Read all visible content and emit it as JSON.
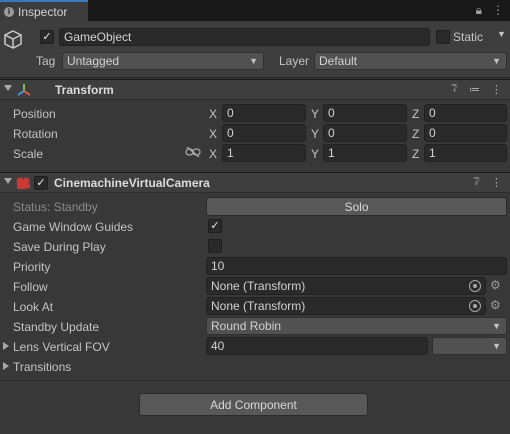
{
  "tab": {
    "title": "Inspector",
    "icon": "info-icon"
  },
  "tab_actions": {
    "lock": "lock-icon",
    "menu": "menu-icon"
  },
  "header": {
    "name": "GameObject",
    "active": true,
    "static_label": "Static",
    "tag_label": "Tag",
    "tag_value": "Untagged",
    "layer_label": "Layer",
    "layer_value": "Default"
  },
  "transform": {
    "title": "Transform",
    "rows": [
      {
        "label": "Position",
        "x": "0",
        "y": "0",
        "z": "0"
      },
      {
        "label": "Rotation",
        "x": "0",
        "y": "0",
        "z": "0"
      },
      {
        "label": "Scale",
        "x": "1",
        "y": "1",
        "z": "1"
      }
    ],
    "axis_x": "X",
    "axis_y": "Y",
    "axis_z": "Z"
  },
  "vcam": {
    "title": "CinemachineVirtualCamera",
    "enabled": true,
    "status": "Status: Standby",
    "solo": "Solo",
    "game_window_guides": "Game Window Guides",
    "game_window_guides_checked": true,
    "save_during_play": "Save During Play",
    "save_during_play_checked": false,
    "priority_label": "Priority",
    "priority_value": "10",
    "follow_label": "Follow",
    "follow_value": "None (Transform)",
    "lookat_label": "Look At",
    "lookat_value": "None (Transform)",
    "standby_label": "Standby Update",
    "standby_value": "Round Robin",
    "fov_label": "Lens Vertical FOV",
    "fov_value": "40",
    "transitions_label": "Transitions"
  },
  "add_component": "Add Component",
  "colors": {
    "accent": "#3a79bb",
    "panel": "#383838",
    "header": "#3e3e3e",
    "field": "#2a2a2a"
  }
}
